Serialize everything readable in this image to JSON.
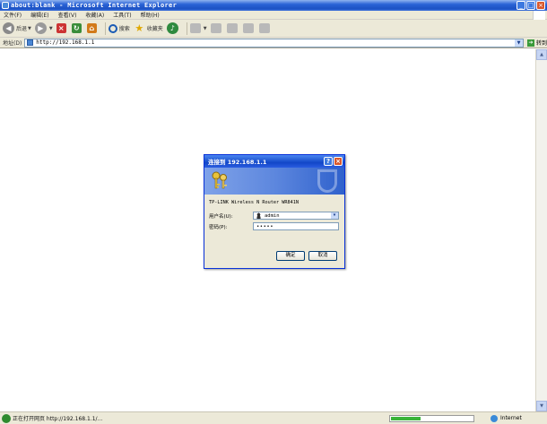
{
  "window": {
    "title": "about:blank - Microsoft Internet Explorer",
    "controls": {
      "minimize": "_",
      "maximize": "□",
      "close": "×"
    }
  },
  "menu": {
    "items": [
      "文件(F)",
      "编辑(E)",
      "查看(V)",
      "收藏(A)",
      "工具(T)",
      "帮助(H)"
    ]
  },
  "toolbar": {
    "back_label": "后退",
    "search_label": "搜索",
    "favorites_label": "收藏夹"
  },
  "address": {
    "label": "地址(D)",
    "url": "http://192.168.1.1",
    "go_label": "转到"
  },
  "status": {
    "text": "正在打开网页 http://192.168.1.1/...",
    "zone": "Internet",
    "progress": 0.36
  },
  "dialog": {
    "title": "连接到 192.168.1.1",
    "message": "TP-LINK Wireless N Router WR841N",
    "username_label": "用户名(U):",
    "username_value": "admin",
    "password_label": "密码(P):",
    "password_value": "•••••",
    "ok_label": "确定",
    "cancel_label": "取消",
    "help_glyph": "?",
    "close_glyph": "×"
  },
  "icons": {
    "colors": {
      "titlebar": "#2a63d6",
      "dialog_titlebar": "#1247c8",
      "chrome": "#ece9d8"
    }
  }
}
